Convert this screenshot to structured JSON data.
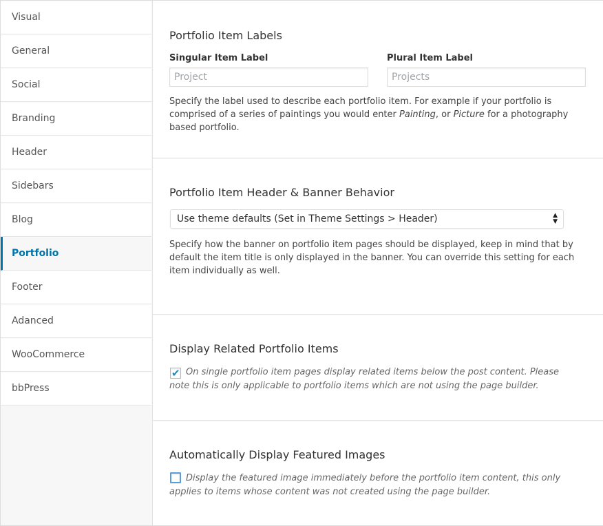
{
  "sidebar": {
    "items": [
      {
        "label": "Visual",
        "active": false
      },
      {
        "label": "General",
        "active": false
      },
      {
        "label": "Social",
        "active": false
      },
      {
        "label": "Branding",
        "active": false
      },
      {
        "label": "Header",
        "active": false
      },
      {
        "label": "Sidebars",
        "active": false
      },
      {
        "label": "Blog",
        "active": false
      },
      {
        "label": "Portfolio",
        "active": true
      },
      {
        "label": "Footer",
        "active": false
      },
      {
        "label": "Adanced",
        "active": false
      },
      {
        "label": "WooCommerce",
        "active": false
      },
      {
        "label": "bbPress",
        "active": false
      }
    ]
  },
  "labels_section": {
    "title": "Portfolio Item Labels",
    "singular_label": "Singular Item Label",
    "singular_placeholder": "Project",
    "plural_label": "Plural Item Label",
    "plural_placeholder": "Projects",
    "desc_part1": "Specify the label used to describe each portfolio item. For example if your portfolio is comprised of a series of paintings you would enter ",
    "desc_em1": "Painting",
    "desc_part2": ", or ",
    "desc_em2": "Picture",
    "desc_part3": " for a photography based portfolio."
  },
  "banner_section": {
    "title": "Portfolio Item Header & Banner Behavior",
    "selected_option": "Use theme defaults (Set in Theme Settings > Header)",
    "description": "Specify how the banner on portfolio item pages should be displayed, keep in mind that by default the item title is only displayed in the banner. You can override this setting for each item individually as well."
  },
  "related_section": {
    "title": "Display Related Portfolio Items",
    "checked": true,
    "checkbox_text": "On single portfolio item pages display related items below the post content. Please note this is only applicable to portfolio items which are not using the page builder."
  },
  "featured_section": {
    "title": "Automatically Display Featured Images",
    "checked": false,
    "checkbox_text": "Display the featured image immediately before the portfolio item content, this only applies to items whose content was not created using the page builder."
  },
  "colors": {
    "accent": "#0073aa",
    "checkbox_focus": "#5b9dd9"
  },
  "icons": {
    "select_arrow": "up-down-arrows-icon",
    "check": "checkmark-icon"
  }
}
